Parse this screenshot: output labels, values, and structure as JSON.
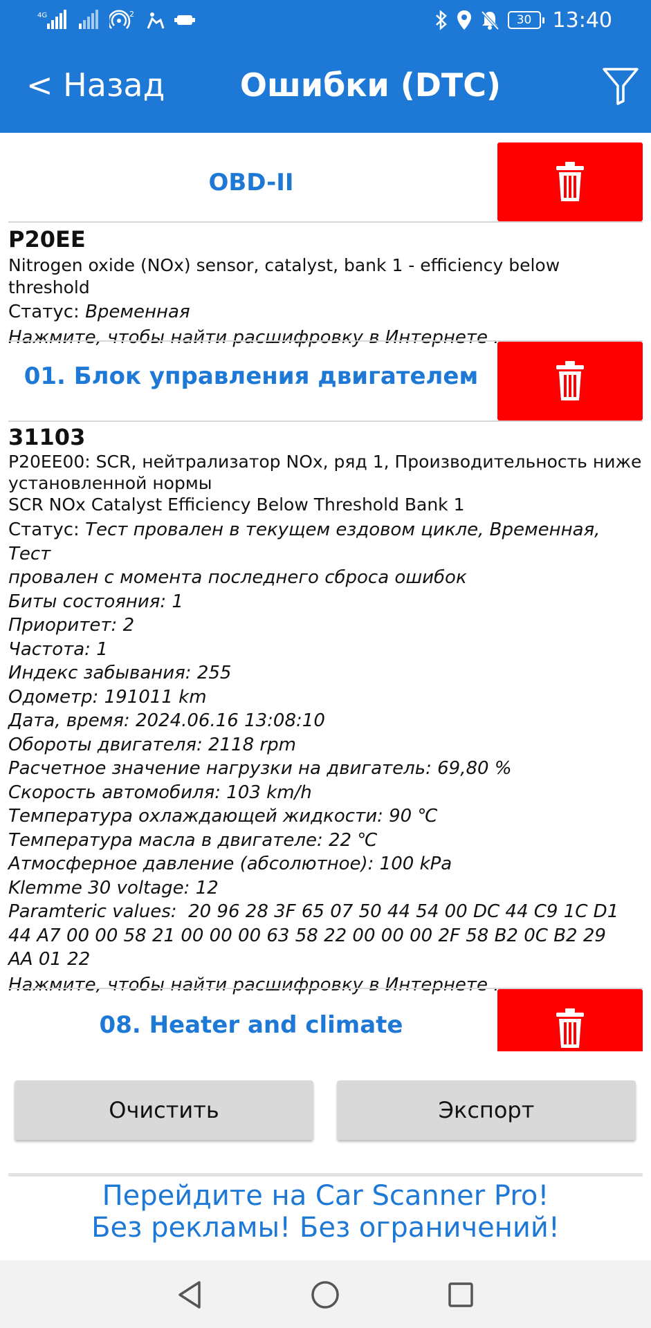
{
  "status_bar": {
    "time": "13:40",
    "battery": "30",
    "network_label": "4G",
    "wifi_label": "2",
    "icons": [
      "signal-icon",
      "signal-weak-icon",
      "hotspot-icon",
      "car-connection-icon",
      "obd-adapter-icon",
      "bluetooth-icon",
      "location-icon",
      "mute-bell-icon",
      "battery-icon"
    ]
  },
  "header": {
    "back_label": "< Назад",
    "title": "Ошибки (DTC)",
    "filter_icon": "filter-icon"
  },
  "sections": [
    {
      "title": "OBD-II",
      "dtcs": [
        {
          "code": "P20EE",
          "description": "Nitrogen oxide (NOx) sensor, catalyst, bank 1 - efficiency below threshold",
          "status_label": "Статус: ",
          "status_value": "Временная",
          "search_hint": "Нажмите, чтобы найти расшифровку в Интернете ..."
        }
      ]
    },
    {
      "title": "01. Блок управления двигателем",
      "dtcs": [
        {
          "code": "31103",
          "description_lines": [
            "P20EE00: SCR, нейтрализатор NOx, ряд 1, Производительность ниже",
            "установленной нормы",
            "SCR NOx Catalyst Efficiency Below Threshold Bank 1"
          ],
          "status_label": "Статус: ",
          "status_value_lines": [
            "Тест провален в текущем ездовом цикле, Временная, Тест",
            "провален с момента последнего сброса ошибок"
          ],
          "details": [
            "Биты состояния: 1",
            "Приоритет: 2",
            "Частота: 1",
            "Индекс забывания: 255",
            "Одометр: 191011 km",
            "Дата, время: 2024.06.16 13:08:10",
            "Обороты двигателя: 2118 rpm",
            "Расчетное значение нагрузки на двигатель: 69,80 %",
            "Скорость автомобиля: 103 km/h",
            "Температура охлаждающей жидкости: 90 ℃",
            "Температура масла в двигателе: 22 ℃",
            "Атмосферное давление (абсолютное): 100 kPa",
            "Klemme 30 voltage: 12",
            "Paramteric values:  20 96 28 3F 65 07 50 44 54 00 DC 44 C9 1C D1",
            "44 A7 00 00 58 21 00 00 00 63 58 22 00 00 00 2F 58 B2 0C B2 29",
            "AA 01 22"
          ],
          "search_hint": "Нажмите, чтобы найти расшифровку в Интернете ..."
        }
      ]
    },
    {
      "title": "08. Heater and climate",
      "dtcs": []
    }
  ],
  "buttons": {
    "clear": "Очистить",
    "export": "Экспорт"
  },
  "ad": {
    "line1": "Перейдите на Car Scanner Pro!",
    "line2": "Без рекламы! Без ограничений!"
  },
  "colors": {
    "primary": "#1e78d6",
    "delete": "#ff0000",
    "button_gray": "#d9d9d9"
  }
}
